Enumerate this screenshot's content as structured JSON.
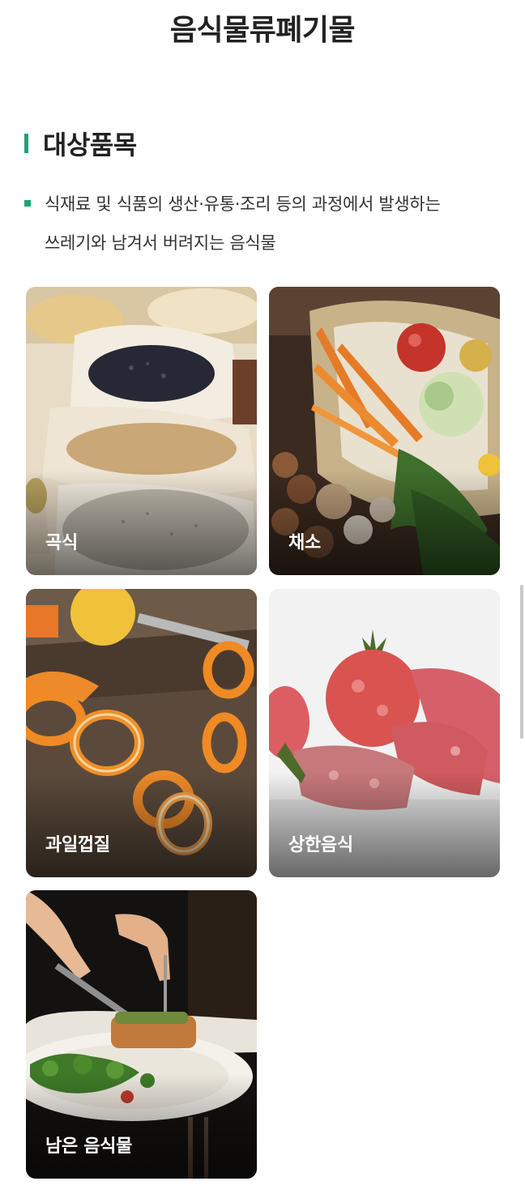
{
  "page": {
    "title": "음식물류폐기물"
  },
  "section": {
    "title": "대상품목",
    "description_line1": "식재료 및 식품의 생산·유통·조리 등의 과정에서 발생하는",
    "description_line2": "쓰레기와 남겨서 버려지는 음식물"
  },
  "categories": [
    {
      "label": "곡식",
      "icon": "grain-sacks-photo"
    },
    {
      "label": "채소",
      "icon": "vegetable-basket-photo"
    },
    {
      "label": "과일껍질",
      "icon": "fruit-peel-photo"
    },
    {
      "label": "상한음식",
      "icon": "spoiled-food-photo"
    },
    {
      "label": "남은 음식물",
      "icon": "leftover-plate-photo"
    }
  ],
  "colors": {
    "accent": "#1aa37a",
    "text": "#222222",
    "background": "#ffffff"
  }
}
